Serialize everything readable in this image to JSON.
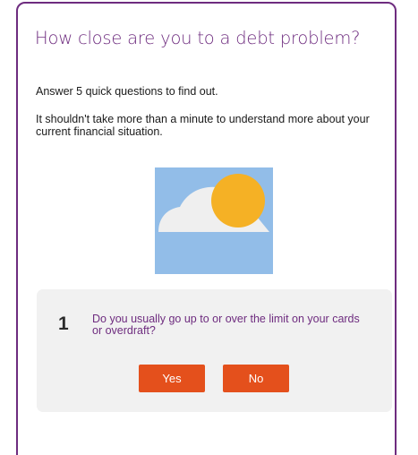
{
  "quiz": {
    "title": "How close are you to a debt problem?",
    "intro": "Answer 5 quick questions to find out.",
    "description": "It shouldn't take more than a minute to understand more about your current financial situation.",
    "illustration": {
      "icon": "sun-behind-cloud-icon",
      "colors": {
        "sky": "#92bde8",
        "sun": "#f5b125",
        "cloud": "#efefef"
      }
    },
    "question": {
      "number": "1",
      "text": "Do you usually go up to or over the limit on your cards or overdraft?",
      "yes_label": "Yes",
      "no_label": "No"
    }
  },
  "colors": {
    "brand": "#6e2c7f",
    "button": "#e4501c",
    "panel": "#f1f1f1"
  }
}
